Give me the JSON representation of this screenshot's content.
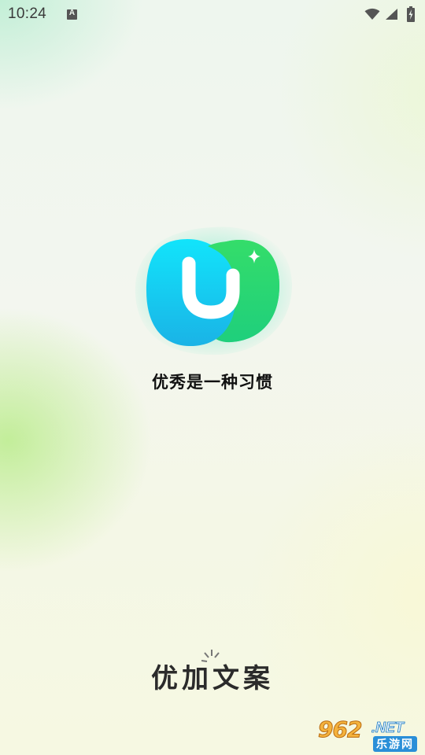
{
  "status_bar": {
    "time": "10:24",
    "notification_icon": "text-a-icon",
    "notification_glyph": "A",
    "icons": [
      "wifi-icon",
      "cell-signal-icon",
      "battery-charging-icon"
    ]
  },
  "splash": {
    "logo_icon": "app-logo-u-icon",
    "logo_colors": {
      "blue": "#14d7f5",
      "green": "#2bd96f",
      "sparkle": "#ffffff"
    },
    "slogan": "优秀是一种习惯",
    "app_name": "优加文案"
  },
  "watermark": {
    "number": "962",
    "domain": ".NET",
    "site_name": "乐游网"
  }
}
